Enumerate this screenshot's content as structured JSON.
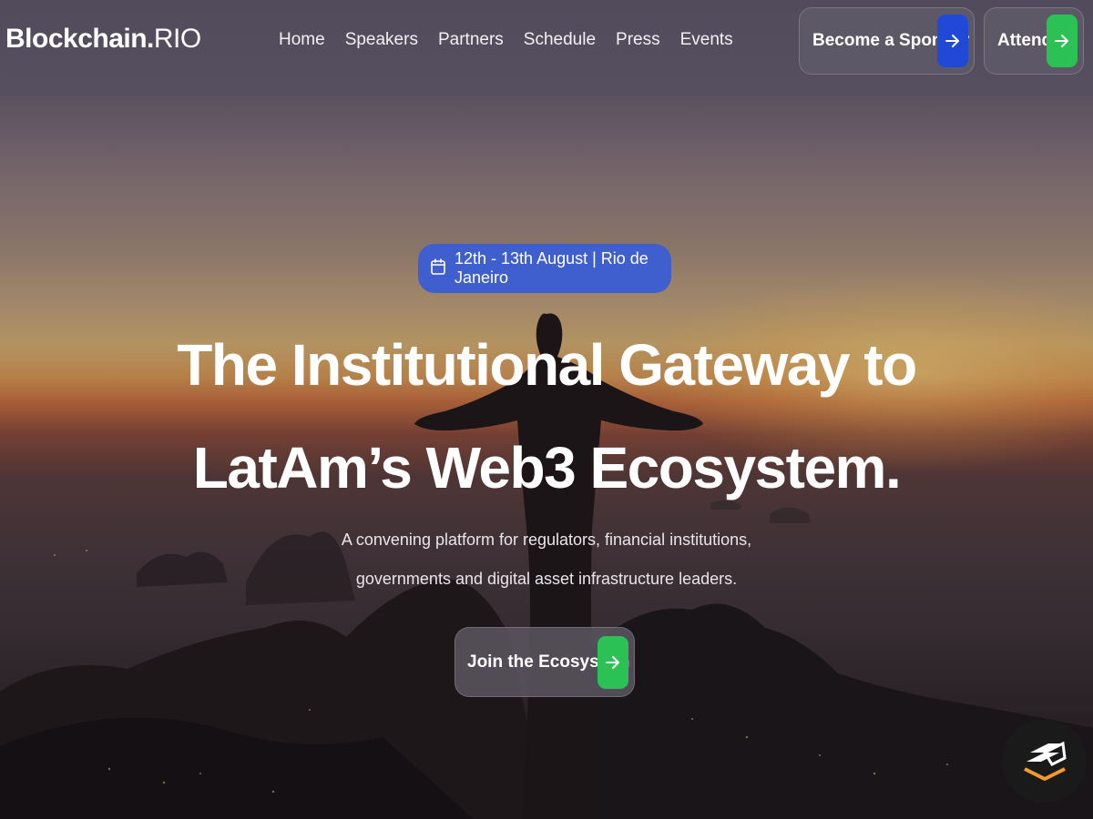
{
  "logo": {
    "bold": "Blockchain.",
    "light": "RIO"
  },
  "nav": {
    "links": [
      "Home",
      "Speakers",
      "Partners",
      "Schedule",
      "Press",
      "Events"
    ],
    "sponsor_label": "Become a Sponsor",
    "attend_label": "Attend"
  },
  "hero": {
    "date": "12th - 13th August | Rio de Janeiro",
    "headline_line1": "The Institutional Gateway to",
    "headline_line2": "LatAm’s Web3 Ecosystem.",
    "subtitle_line1": "A convening platform for regulators, financial institutions,",
    "subtitle_line2": "governments and digital asset infrastructure leaders.",
    "cta_label": "Join the Ecosystem"
  },
  "colors": {
    "sponsor_accent": "#2049d8",
    "attend_accent": "#2cc155",
    "date_pill": "#3f5fcf"
  },
  "icons": {
    "date": "calendar-icon",
    "button_arrow": "arrow-right-icon",
    "corner_badge": "stack-layers-icon"
  }
}
